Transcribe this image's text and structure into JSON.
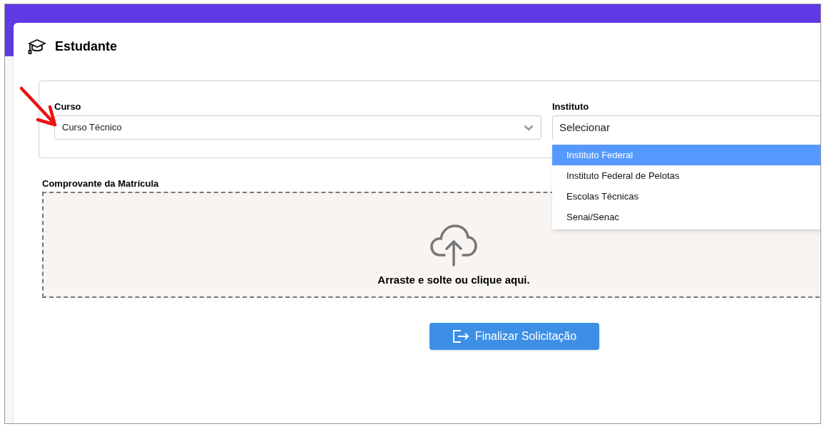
{
  "card": {
    "title": "Estudante"
  },
  "curso": {
    "label": "Curso",
    "value": "Curso Técnico"
  },
  "instituto": {
    "label": "Instituto",
    "value": "Selecionar",
    "expanded": true,
    "options": [
      {
        "label": "Instituto Federal",
        "selected": true
      },
      {
        "label": "Instituto Federal de Pelotas",
        "selected": false
      },
      {
        "label": "Escolas Técnicas",
        "selected": false
      },
      {
        "label": "Senai/Senac",
        "selected": false
      }
    ]
  },
  "upload": {
    "label": "Comprovante da Matrícula",
    "hint": "Arraste e solte ou clique aqui."
  },
  "submit_button": "Finalizar Solicitação"
}
